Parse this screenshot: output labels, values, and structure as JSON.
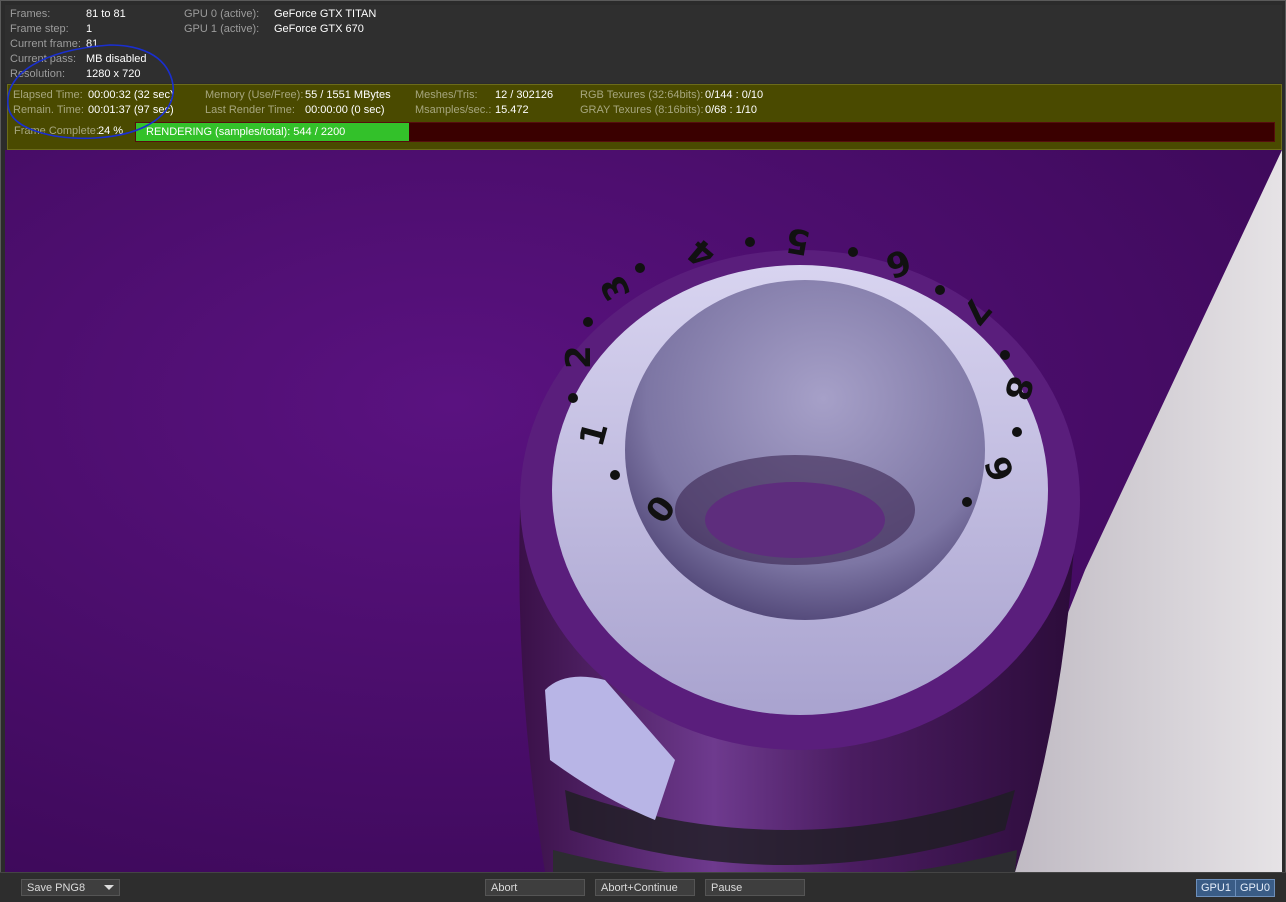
{
  "frame_info": {
    "frames_label": "Frames:",
    "frames_value": "81 to 81",
    "frame_step_label": "Frame step:",
    "frame_step_value": "1",
    "current_frame_label": "Current frame:",
    "current_frame_value": "81",
    "current_pass_label": "Current pass:",
    "current_pass_value": "MB disabled",
    "resolution_label": "Resolution:",
    "resolution_value": "1280 x 720"
  },
  "gpus": [
    {
      "label": "GPU  0 (active):",
      "name": "GeForce GTX TITAN"
    },
    {
      "label": "GPU  1 (active):",
      "name": "GeForce GTX 670"
    }
  ],
  "stats": {
    "elapsed_label": "Elapsed Time:",
    "elapsed_value": "00:00:32 (32 sec)",
    "remain_label": "Remain. Time:",
    "remain_value": "00:01:37 (97 sec)",
    "memory_label": "Memory (Use/Free):",
    "memory_value": "55 / 1551 MBytes",
    "last_render_label": "Last Render Time:",
    "last_render_value": "00:00:00 (0 sec)",
    "meshes_label": "Meshes/Tris:",
    "meshes_value": "12 / 302126",
    "msamples_label": "Msamples/sec.:",
    "msamples_value": "15.472",
    "rgb_tex_label": "RGB Texures (32:64bits):",
    "rgb_tex_value": "0/144 : 0/10",
    "gray_tex_label": "GRAY Texures (8:16bits):",
    "gray_tex_value": "0/68 : 1/10"
  },
  "progress": {
    "label": "Frame Complete:",
    "percent_text": "24 %",
    "fraction": 0.24,
    "status_text": "RENDERING (samples/total): 544 / 2200"
  },
  "dial_numbers": [
    "0",
    "1",
    "2",
    "3",
    "4",
    "5",
    "6",
    "7",
    "8",
    "9"
  ],
  "toolbar": {
    "save_format": "Save PNG8",
    "abort": "Abort",
    "abort_continue": "Abort+Continue",
    "pause": "Pause",
    "gpu1": "GPU1",
    "gpu0": "GPU0"
  },
  "colors": {
    "panel": "#2f2f2f",
    "stats_bg": "#4a4a00",
    "progress_fill": "#33c12a",
    "progress_track": "#3a0000",
    "render_purple": "#4b0d6b",
    "annotation": "#1a2fd0"
  }
}
